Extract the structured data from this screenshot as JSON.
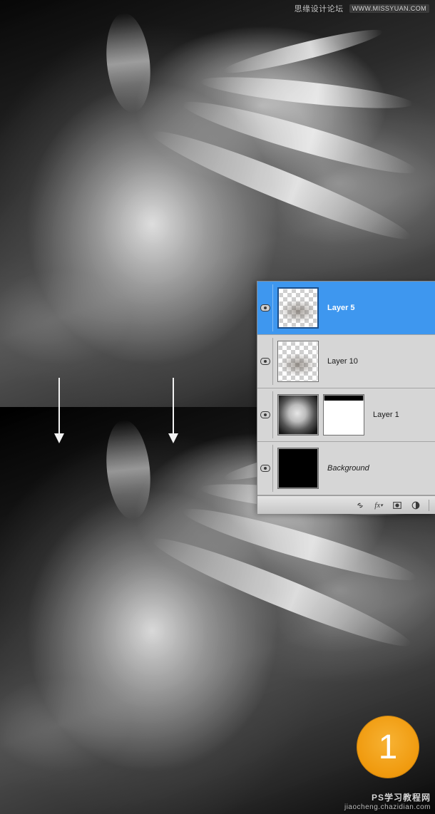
{
  "watermark_top": {
    "text": "思缘设计论坛",
    "url": "WWW.MISSYUAN.COM"
  },
  "watermark_bottom": {
    "line1": "PS学习教程网",
    "line2": "jiaocheng.chazidian.com"
  },
  "step": {
    "number": "1"
  },
  "layers_panel": {
    "layers": [
      {
        "name": "Layer 5",
        "selected": true,
        "visible": true,
        "thumb": "checker",
        "mask": null
      },
      {
        "name": "Layer 10",
        "selected": false,
        "visible": true,
        "thumb": "checker",
        "mask": null
      },
      {
        "name": "Layer 1",
        "selected": false,
        "visible": true,
        "thumb": "dark",
        "mask": "mask"
      },
      {
        "name": "Background",
        "selected": false,
        "visible": true,
        "thumb": "black",
        "mask": null,
        "italic": true
      }
    ],
    "footer_icons": [
      "link-icon",
      "fx-icon",
      "mask-icon",
      "adjustment-icon",
      "group-icon"
    ]
  }
}
